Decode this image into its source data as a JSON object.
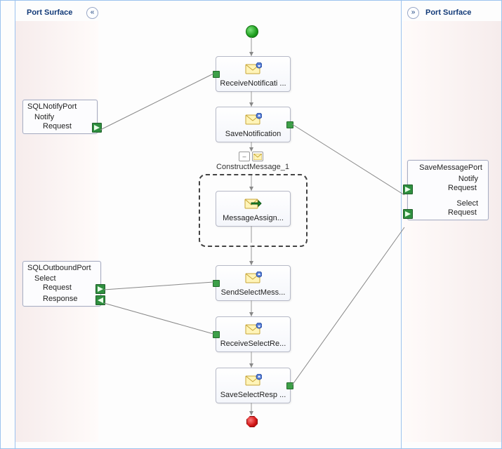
{
  "headers": {
    "left_title": "Port Surface",
    "right_title": "Port Surface"
  },
  "left_ports": {
    "notify": {
      "title": "SQLNotifyPort",
      "operation": "Notify",
      "messages": [
        "Request"
      ]
    },
    "outbound": {
      "title": "SQLOutboundPort",
      "operation": "Select",
      "messages": [
        "Request",
        "Response"
      ]
    }
  },
  "right_ports": {
    "save": {
      "title": "SaveMessagePort",
      "op1": "Notify",
      "op1_msg": "Request",
      "op2": "Select",
      "op2_msg": "Request"
    }
  },
  "shapes": {
    "receive_notification": "ReceiveNotificati ...",
    "save_notification": "SaveNotification",
    "construct_title": "ConstructMessage_1",
    "message_assign": "MessageAssign...",
    "send_select": "SendSelectMess...",
    "receive_select": "ReceiveSelectRe...",
    "save_select_resp": "SaveSelectResp ..."
  }
}
